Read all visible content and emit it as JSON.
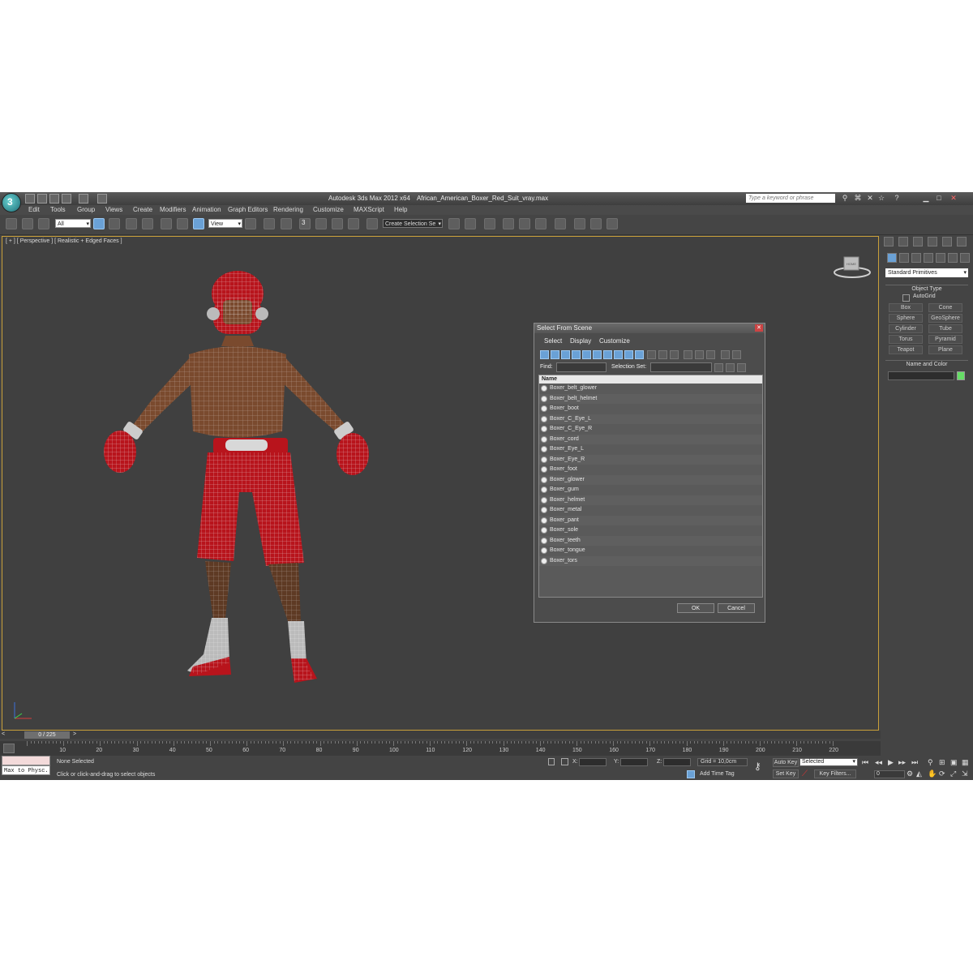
{
  "window": {
    "app_title": "Autodesk 3ds Max  2012 x64",
    "file_name": "African_American_Boxer_Red_Suit_vray.max",
    "search_placeholder": "Type a keyword or phrase",
    "logo_glyph": "3"
  },
  "menu": [
    "Edit",
    "Tools",
    "Group",
    "Views",
    "Create",
    "Modifiers",
    "Animation",
    "Graph Editors",
    "Rendering",
    "Customize",
    "MAXScript",
    "Help"
  ],
  "toolbar": {
    "filter_value": "All",
    "ref_coord_value": "View",
    "snap_label": "3",
    "selection_set_value": "Create Selection Se"
  },
  "viewport": {
    "label": "[ + ] [ Perspective ] [ Realistic + Edged Faces ]",
    "viewcube_label": "HOME"
  },
  "dialog": {
    "title": "Select From Scene",
    "menu": [
      "Select",
      "Display",
      "Customize"
    ],
    "find_label": "Find:",
    "selection_set_label": "Selection Set:",
    "column_header": "Name",
    "items": [
      "Boxer_belt_glower",
      "Boxer_belt_helmet",
      "Boxer_boot",
      "Boxer_C_Eye_L",
      "Boxer_C_Eye_R",
      "Boxer_cord",
      "Boxer_Eye_L",
      "Boxer_Eye_R",
      "Boxer_foot",
      "Boxer_glower",
      "Boxer_gum",
      "Boxer_helmet",
      "Boxer_metal",
      "Boxer_pant",
      "Boxer_sole",
      "Boxer_teeth",
      "Boxer_tongue",
      "Boxer_tors"
    ],
    "ok_label": "OK",
    "cancel_label": "Cancel"
  },
  "command_panel": {
    "category": "Standard Primitives",
    "object_type_title": "Object Type",
    "autogrid_label": "AutoGrid",
    "buttons": [
      "Box",
      "Cone",
      "Sphere",
      "GeoSphere",
      "Cylinder",
      "Tube",
      "Torus",
      "Pyramid",
      "Teapot",
      "Plane"
    ],
    "name_color_title": "Name and Color",
    "swatch_color": "#66dd66"
  },
  "timeline": {
    "frame_display": "0 / 225",
    "ticks": [
      "0",
      "10",
      "20",
      "30",
      "40",
      "50",
      "60",
      "70",
      "80",
      "90",
      "100",
      "110",
      "120",
      "130",
      "140",
      "150",
      "160",
      "170",
      "180",
      "190",
      "200",
      "210",
      "220"
    ]
  },
  "status": {
    "maxscript_label": "Max to Physc.",
    "selection_status": "None Selected",
    "prompt": "Click or click-and-drag to select objects",
    "x_label": "X:",
    "y_label": "Y:",
    "z_label": "Z:",
    "grid": "Grid = 10,0cm",
    "add_time_tag": "Add Time Tag",
    "auto_key": "Auto Key",
    "auto_key_value": "Selected",
    "set_key": "Set Key",
    "key_filters": "Key Filters...",
    "current_frame": "0"
  },
  "colors": {
    "accent": "#6aa1d6",
    "viewport_border": "#c9a03a",
    "suit_red": "#b8141c",
    "skin": "#7a4a2e"
  }
}
